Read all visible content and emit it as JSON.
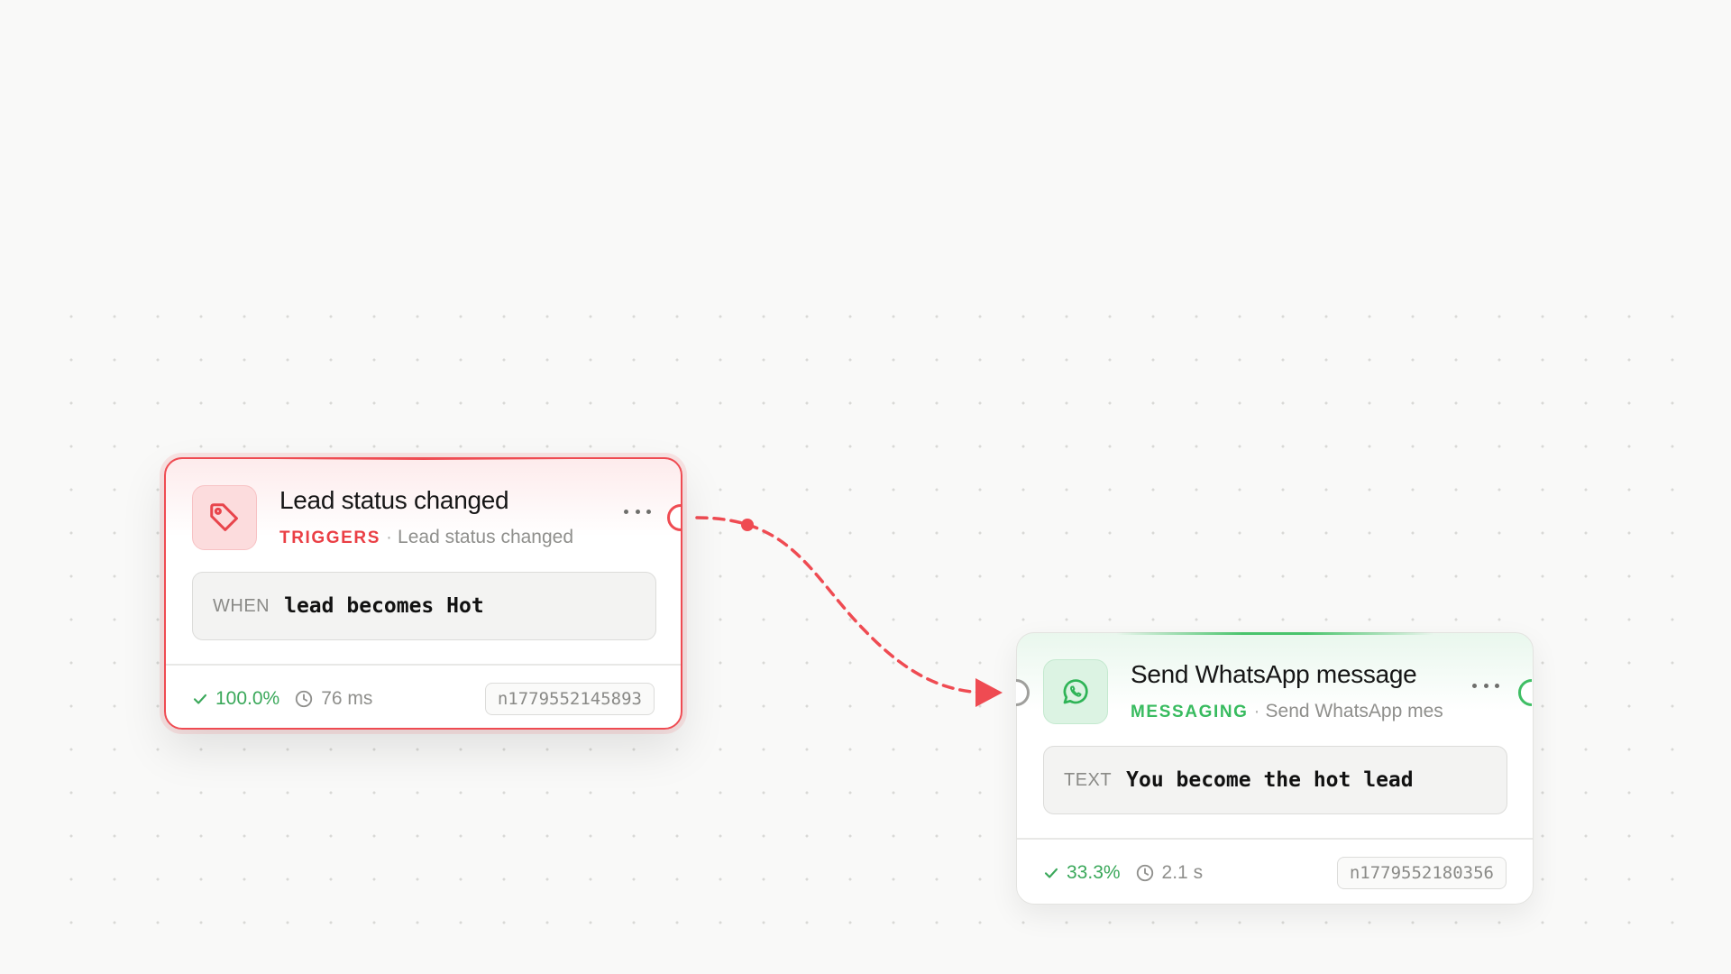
{
  "nodes": [
    {
      "title": "Lead status changed",
      "category": "TRIGGERS",
      "separator": "·",
      "subtitle": "Lead status changed",
      "config_key": "WHEN",
      "config_value": "lead becomes Hot",
      "success_rate": "100.0%",
      "duration": "76 ms",
      "node_id": "n1779552145893",
      "icon": "tag-icon",
      "accent": "#ef4b52"
    },
    {
      "title": "Send WhatsApp message",
      "category": "MESSAGING",
      "separator": "·",
      "subtitle": "Send WhatsApp message",
      "config_key": "TEXT",
      "config_value": "You become the hot lead",
      "success_rate": "33.3%",
      "duration": "2.1 s",
      "node_id": "n1779552180356",
      "icon": "whatsapp-icon",
      "accent": "#3fbe64"
    }
  ],
  "edge": {
    "color": "#ef4b52",
    "style": "dashed"
  }
}
